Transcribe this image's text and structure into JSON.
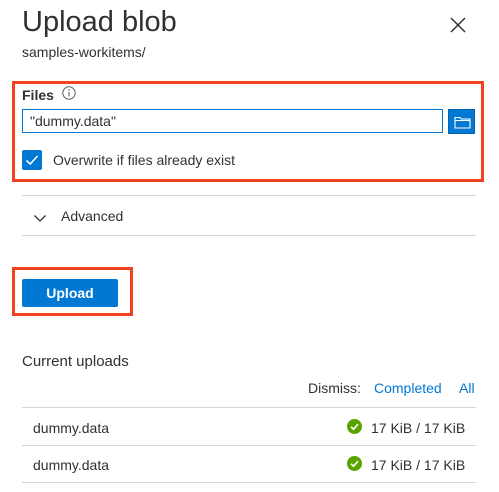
{
  "panel": {
    "title": "Upload blob",
    "subtitle": "samples-workitems/"
  },
  "files": {
    "label": "Files",
    "value": "\"dummy.data\""
  },
  "overwrite": {
    "label": "Overwrite if files already exist",
    "checked": true
  },
  "advanced": {
    "label": "Advanced"
  },
  "upload": {
    "button_label": "Upload"
  },
  "current_uploads": {
    "title": "Current uploads",
    "dismiss_label": "Dismiss:",
    "dismiss_completed": "Completed",
    "dismiss_all": "All",
    "items": [
      {
        "name": "dummy.data",
        "status": "17 KiB / 17 KiB",
        "icon": "check-circle-icon"
      },
      {
        "name": "dummy.data",
        "status": "17 KiB / 17 KiB",
        "icon": "check-circle-icon"
      }
    ]
  },
  "colors": {
    "accent": "#0078d4",
    "highlight": "#f2411f",
    "success": "#57a300"
  }
}
